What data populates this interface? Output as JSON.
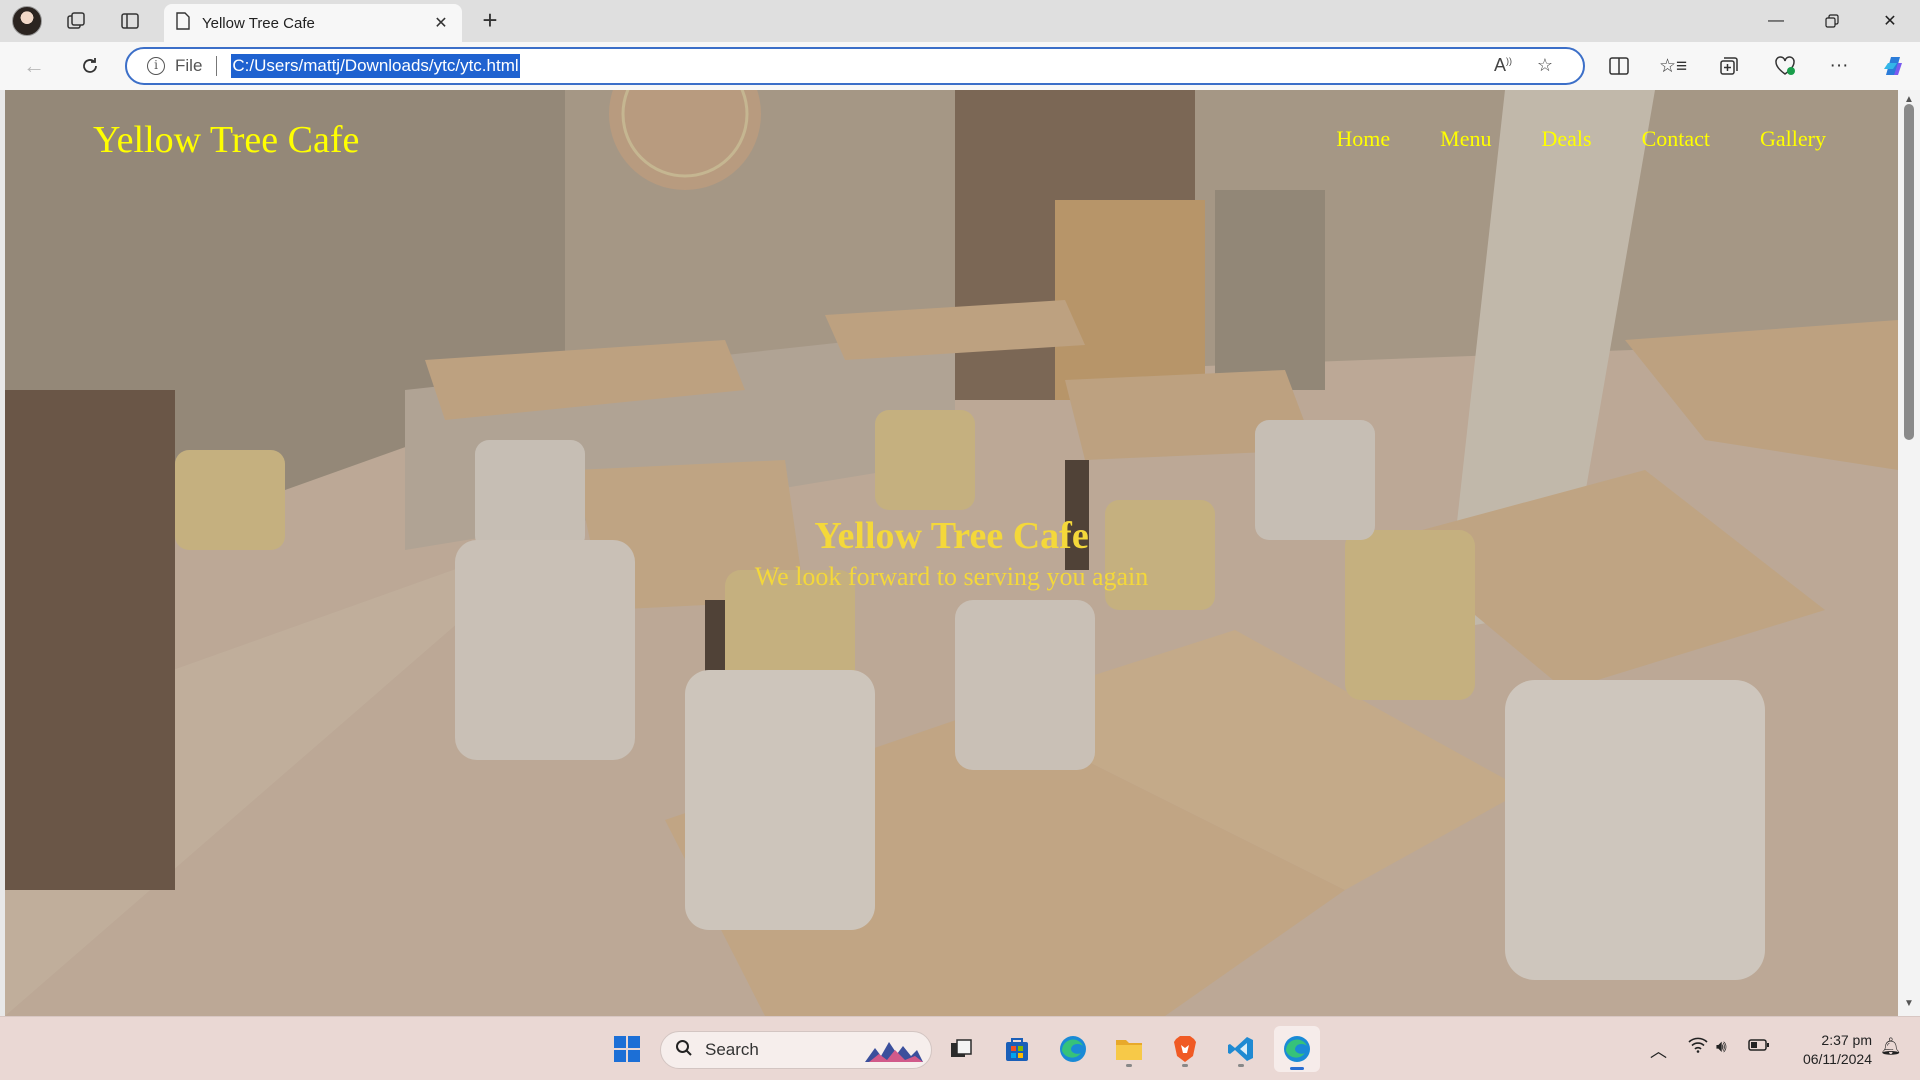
{
  "browser": {
    "tab_title": "Yellow Tree Cafe",
    "file_label": "File",
    "url": "C:/Users/mattj/Downloads/ytc/ytc.html"
  },
  "site": {
    "logo": "Yellow Tree Cafe",
    "nav": [
      "Home",
      "Menu",
      "Deals",
      "Contact",
      "Gallery"
    ],
    "hero_title": "Yellow Tree Cafe",
    "hero_subtitle": "We look forward to serving you again",
    "accent_color": "#ffff00"
  },
  "taskbar": {
    "search_label": "Search",
    "time": "2:37 pm",
    "date": "06/11/2024",
    "apps": [
      "start-icon",
      "search",
      "task-view-icon",
      "store-icon",
      "edge-icon",
      "file-explorer-icon",
      "brave-icon",
      "vscode-icon",
      "edge-active-icon"
    ]
  }
}
